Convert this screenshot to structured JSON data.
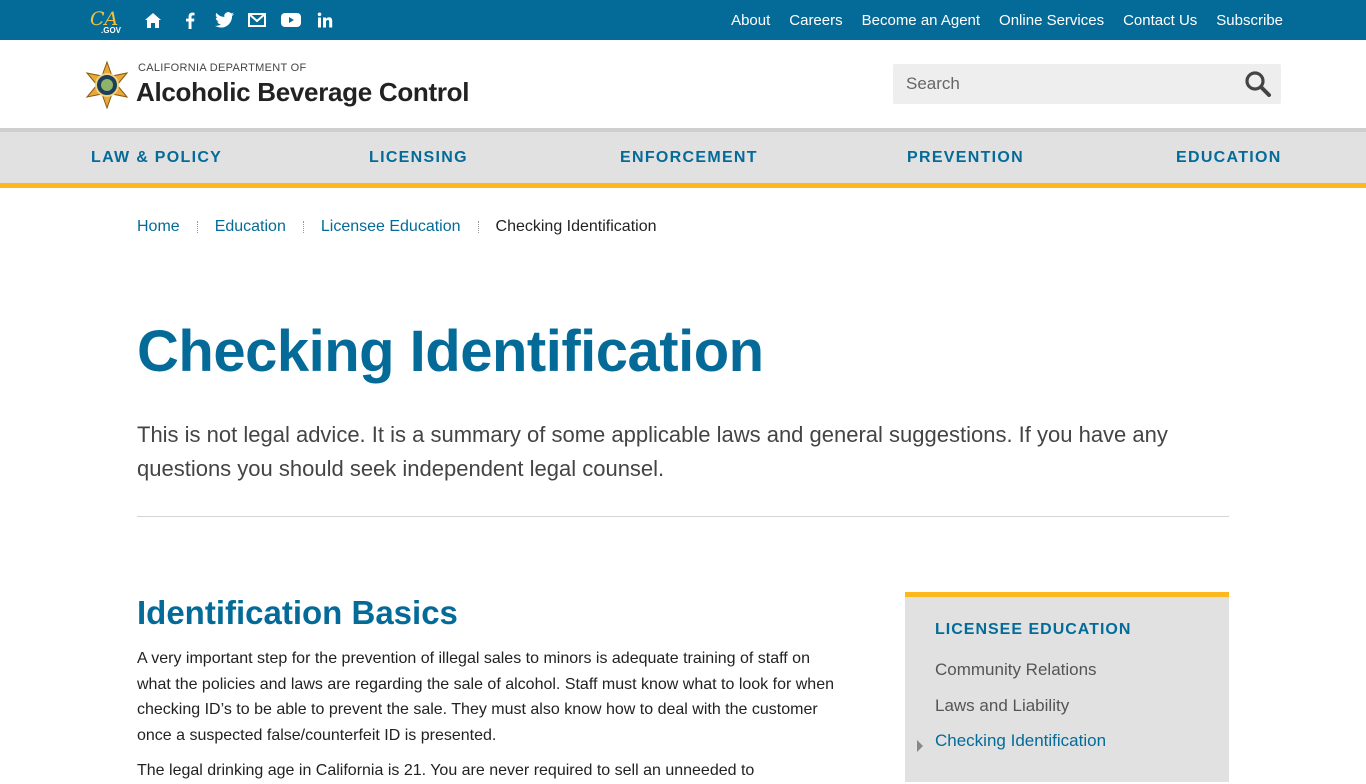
{
  "utility": {
    "cagov_text": "CA",
    "cagov_suffix": ".GOV",
    "social_icons": [
      "home-icon",
      "facebook-icon",
      "twitter-icon",
      "email-icon",
      "youtube-icon",
      "linkedin-icon"
    ],
    "links": [
      "About",
      "Careers",
      "Become an Agent",
      "Online Services",
      "Contact Us",
      "Subscribe"
    ]
  },
  "header": {
    "logo_small": "CALIFORNIA DEPARTMENT OF",
    "logo_big": "Alcoholic Beverage Control",
    "search_placeholder": "Search"
  },
  "nav": {
    "items": [
      "LAW & POLICY",
      "LICENSING",
      "ENFORCEMENT",
      "PREVENTION",
      "EDUCATION"
    ]
  },
  "breadcrumb": {
    "items": [
      "Home",
      "Education",
      "Licensee Education"
    ],
    "current": "Checking Identification"
  },
  "page": {
    "title": "Checking Identification",
    "lead": "This is not legal advice. It is a summary of some applicable laws and general suggestions. If you have any questions you should seek independent legal counsel.",
    "section_title": "Identification Basics",
    "paragraph1": "A very important step for the prevention of illegal sales to minors is adequate training of staff on what the policies and laws are regarding the sale of alcohol. Staff must know what to look for when checking ID’s to be able to prevent the sale. They must also know how to deal with the customer once a suspected false/counterfeit ID is presented.",
    "paragraph2": "The legal drinking age in California is 21. You are never required to sell an unneeded to"
  },
  "sidenav": {
    "title": "LICENSEE EDUCATION",
    "items": [
      "Community Relations",
      "Laws and Liability",
      "Checking Identification"
    ],
    "active_index": 2
  },
  "colors": {
    "brand_blue": "#046b99",
    "accent_gold": "#fdb81e",
    "nav_bg": "#e1e1e1"
  }
}
